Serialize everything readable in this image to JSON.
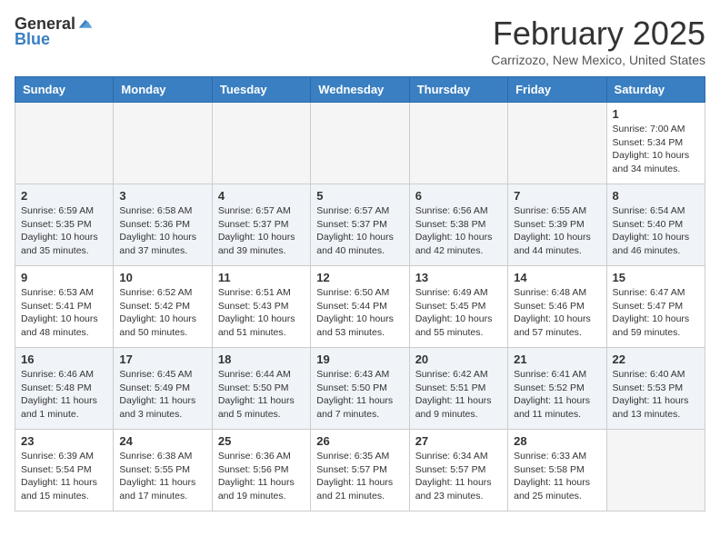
{
  "header": {
    "logo": {
      "general": "General",
      "blue": "Blue"
    },
    "title": "February 2025",
    "location": "Carrizozo, New Mexico, United States"
  },
  "weekdays": [
    "Sunday",
    "Monday",
    "Tuesday",
    "Wednesday",
    "Thursday",
    "Friday",
    "Saturday"
  ],
  "weeks": [
    [
      {
        "day": "",
        "sunrise": "",
        "sunset": "",
        "daylight": "",
        "empty": true
      },
      {
        "day": "",
        "sunrise": "",
        "sunset": "",
        "daylight": "",
        "empty": true
      },
      {
        "day": "",
        "sunrise": "",
        "sunset": "",
        "daylight": "",
        "empty": true
      },
      {
        "day": "",
        "sunrise": "",
        "sunset": "",
        "daylight": "",
        "empty": true
      },
      {
        "day": "",
        "sunrise": "",
        "sunset": "",
        "daylight": "",
        "empty": true
      },
      {
        "day": "",
        "sunrise": "",
        "sunset": "",
        "daylight": "",
        "empty": true
      },
      {
        "day": "1",
        "sunrise": "Sunrise: 7:00 AM",
        "sunset": "Sunset: 5:34 PM",
        "daylight": "Daylight: 10 hours and 34 minutes.",
        "empty": false
      }
    ],
    [
      {
        "day": "2",
        "sunrise": "Sunrise: 6:59 AM",
        "sunset": "Sunset: 5:35 PM",
        "daylight": "Daylight: 10 hours and 35 minutes.",
        "empty": false
      },
      {
        "day": "3",
        "sunrise": "Sunrise: 6:58 AM",
        "sunset": "Sunset: 5:36 PM",
        "daylight": "Daylight: 10 hours and 37 minutes.",
        "empty": false
      },
      {
        "day": "4",
        "sunrise": "Sunrise: 6:57 AM",
        "sunset": "Sunset: 5:37 PM",
        "daylight": "Daylight: 10 hours and 39 minutes.",
        "empty": false
      },
      {
        "day": "5",
        "sunrise": "Sunrise: 6:57 AM",
        "sunset": "Sunset: 5:37 PM",
        "daylight": "Daylight: 10 hours and 40 minutes.",
        "empty": false
      },
      {
        "day": "6",
        "sunrise": "Sunrise: 6:56 AM",
        "sunset": "Sunset: 5:38 PM",
        "daylight": "Daylight: 10 hours and 42 minutes.",
        "empty": false
      },
      {
        "day": "7",
        "sunrise": "Sunrise: 6:55 AM",
        "sunset": "Sunset: 5:39 PM",
        "daylight": "Daylight: 10 hours and 44 minutes.",
        "empty": false
      },
      {
        "day": "8",
        "sunrise": "Sunrise: 6:54 AM",
        "sunset": "Sunset: 5:40 PM",
        "daylight": "Daylight: 10 hours and 46 minutes.",
        "empty": false
      }
    ],
    [
      {
        "day": "9",
        "sunrise": "Sunrise: 6:53 AM",
        "sunset": "Sunset: 5:41 PM",
        "daylight": "Daylight: 10 hours and 48 minutes.",
        "empty": false
      },
      {
        "day": "10",
        "sunrise": "Sunrise: 6:52 AM",
        "sunset": "Sunset: 5:42 PM",
        "daylight": "Daylight: 10 hours and 50 minutes.",
        "empty": false
      },
      {
        "day": "11",
        "sunrise": "Sunrise: 6:51 AM",
        "sunset": "Sunset: 5:43 PM",
        "daylight": "Daylight: 10 hours and 51 minutes.",
        "empty": false
      },
      {
        "day": "12",
        "sunrise": "Sunrise: 6:50 AM",
        "sunset": "Sunset: 5:44 PM",
        "daylight": "Daylight: 10 hours and 53 minutes.",
        "empty": false
      },
      {
        "day": "13",
        "sunrise": "Sunrise: 6:49 AM",
        "sunset": "Sunset: 5:45 PM",
        "daylight": "Daylight: 10 hours and 55 minutes.",
        "empty": false
      },
      {
        "day": "14",
        "sunrise": "Sunrise: 6:48 AM",
        "sunset": "Sunset: 5:46 PM",
        "daylight": "Daylight: 10 hours and 57 minutes.",
        "empty": false
      },
      {
        "day": "15",
        "sunrise": "Sunrise: 6:47 AM",
        "sunset": "Sunset: 5:47 PM",
        "daylight": "Daylight: 10 hours and 59 minutes.",
        "empty": false
      }
    ],
    [
      {
        "day": "16",
        "sunrise": "Sunrise: 6:46 AM",
        "sunset": "Sunset: 5:48 PM",
        "daylight": "Daylight: 11 hours and 1 minute.",
        "empty": false
      },
      {
        "day": "17",
        "sunrise": "Sunrise: 6:45 AM",
        "sunset": "Sunset: 5:49 PM",
        "daylight": "Daylight: 11 hours and 3 minutes.",
        "empty": false
      },
      {
        "day": "18",
        "sunrise": "Sunrise: 6:44 AM",
        "sunset": "Sunset: 5:50 PM",
        "daylight": "Daylight: 11 hours and 5 minutes.",
        "empty": false
      },
      {
        "day": "19",
        "sunrise": "Sunrise: 6:43 AM",
        "sunset": "Sunset: 5:50 PM",
        "daylight": "Daylight: 11 hours and 7 minutes.",
        "empty": false
      },
      {
        "day": "20",
        "sunrise": "Sunrise: 6:42 AM",
        "sunset": "Sunset: 5:51 PM",
        "daylight": "Daylight: 11 hours and 9 minutes.",
        "empty": false
      },
      {
        "day": "21",
        "sunrise": "Sunrise: 6:41 AM",
        "sunset": "Sunset: 5:52 PM",
        "daylight": "Daylight: 11 hours and 11 minutes.",
        "empty": false
      },
      {
        "day": "22",
        "sunrise": "Sunrise: 6:40 AM",
        "sunset": "Sunset: 5:53 PM",
        "daylight": "Daylight: 11 hours and 13 minutes.",
        "empty": false
      }
    ],
    [
      {
        "day": "23",
        "sunrise": "Sunrise: 6:39 AM",
        "sunset": "Sunset: 5:54 PM",
        "daylight": "Daylight: 11 hours and 15 minutes.",
        "empty": false
      },
      {
        "day": "24",
        "sunrise": "Sunrise: 6:38 AM",
        "sunset": "Sunset: 5:55 PM",
        "daylight": "Daylight: 11 hours and 17 minutes.",
        "empty": false
      },
      {
        "day": "25",
        "sunrise": "Sunrise: 6:36 AM",
        "sunset": "Sunset: 5:56 PM",
        "daylight": "Daylight: 11 hours and 19 minutes.",
        "empty": false
      },
      {
        "day": "26",
        "sunrise": "Sunrise: 6:35 AM",
        "sunset": "Sunset: 5:57 PM",
        "daylight": "Daylight: 11 hours and 21 minutes.",
        "empty": false
      },
      {
        "day": "27",
        "sunrise": "Sunrise: 6:34 AM",
        "sunset": "Sunset: 5:57 PM",
        "daylight": "Daylight: 11 hours and 23 minutes.",
        "empty": false
      },
      {
        "day": "28",
        "sunrise": "Sunrise: 6:33 AM",
        "sunset": "Sunset: 5:58 PM",
        "daylight": "Daylight: 11 hours and 25 minutes.",
        "empty": false
      },
      {
        "day": "",
        "sunrise": "",
        "sunset": "",
        "daylight": "",
        "empty": true
      }
    ]
  ]
}
